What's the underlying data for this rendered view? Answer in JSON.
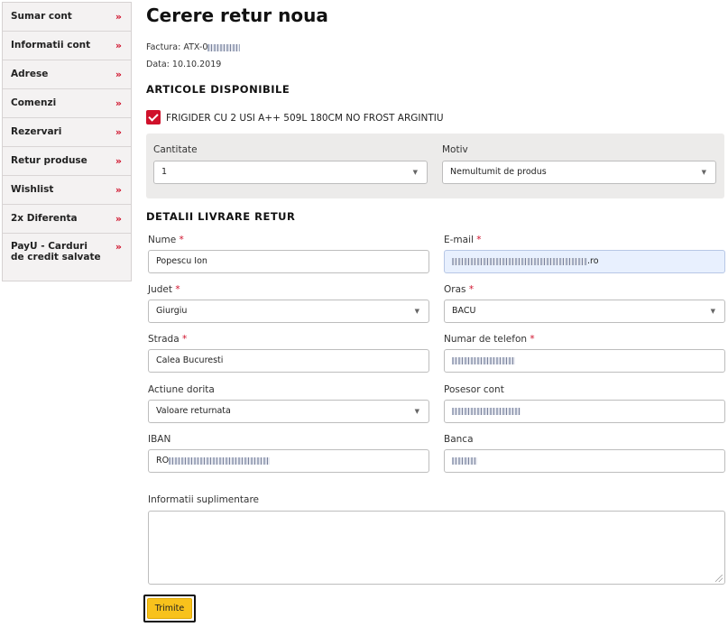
{
  "sidebar": {
    "items": [
      {
        "label": "Sumar cont"
      },
      {
        "label": "Informatii cont"
      },
      {
        "label": "Adrese"
      },
      {
        "label": "Comenzi"
      },
      {
        "label": "Rezervari"
      },
      {
        "label": "Retur produse"
      },
      {
        "label": "Wishlist"
      },
      {
        "label": "2x Diferenta"
      },
      {
        "label": "PayU - Carduri de credit salvate"
      }
    ],
    "chevron": "»"
  },
  "page": {
    "title": "Cerere retur noua",
    "invoice_label": "Factura: ATX-0",
    "date_label": "Data: 10.10.2019"
  },
  "articles": {
    "heading": "ARTICOLE DISPONIBILE",
    "product_name": "FRIGIDER CU 2 USI A++ 509L 180CM NO FROST ARGINTIU",
    "quantity_label": "Cantitate",
    "quantity_value": "1",
    "reason_label": "Motiv",
    "reason_value": "Nemultumit de produs"
  },
  "delivery": {
    "heading": "DETALII LIVRARE RETUR",
    "required_mark": "*",
    "name_label": "Nume",
    "name_value": "Popescu Ion",
    "email_label": "E-mail",
    "email_value_suffix": ".ro",
    "county_label": "Judet",
    "county_value": "Giurgiu",
    "city_label": "Oras",
    "city_value": "BACU",
    "street_label": "Strada",
    "street_value": "Calea Bucuresti",
    "phone_label": "Numar de telefon",
    "action_label": "Actiune dorita",
    "action_value": "Valoare returnata",
    "owner_label": "Posesor cont",
    "iban_label": "IBAN",
    "iban_prefix": "RO",
    "bank_label": "Banca",
    "extra_label": "Informatii suplimentare"
  },
  "submit_label": "Trimite",
  "colors": {
    "accent_red": "#d0112b",
    "button_yellow": "#f8c21c"
  }
}
